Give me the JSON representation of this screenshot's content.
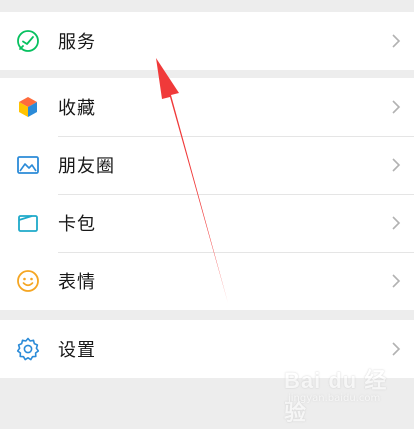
{
  "menu": {
    "group1": [
      {
        "label": "服务",
        "icon": "service-check-icon",
        "color": "#07c160"
      }
    ],
    "group2": [
      {
        "label": "收藏",
        "icon": "favorites-cube-icon",
        "color": "#ff6b3c"
      },
      {
        "label": "朋友圈",
        "icon": "moments-picture-icon",
        "color": "#2b8bd8"
      },
      {
        "label": "卡包",
        "icon": "card-wallet-icon",
        "color": "#1ea9c9"
      },
      {
        "label": "表情",
        "icon": "emoji-smile-icon",
        "color": "#f5a623"
      }
    ],
    "group3": [
      {
        "label": "设置",
        "icon": "settings-gear-icon",
        "color": "#2b8bd8"
      }
    ]
  },
  "annotation": {
    "arrow_color": "#f03a3a"
  },
  "watermark": {
    "text": "Bai du 经验",
    "sub": "jingyan.baidu.com"
  }
}
